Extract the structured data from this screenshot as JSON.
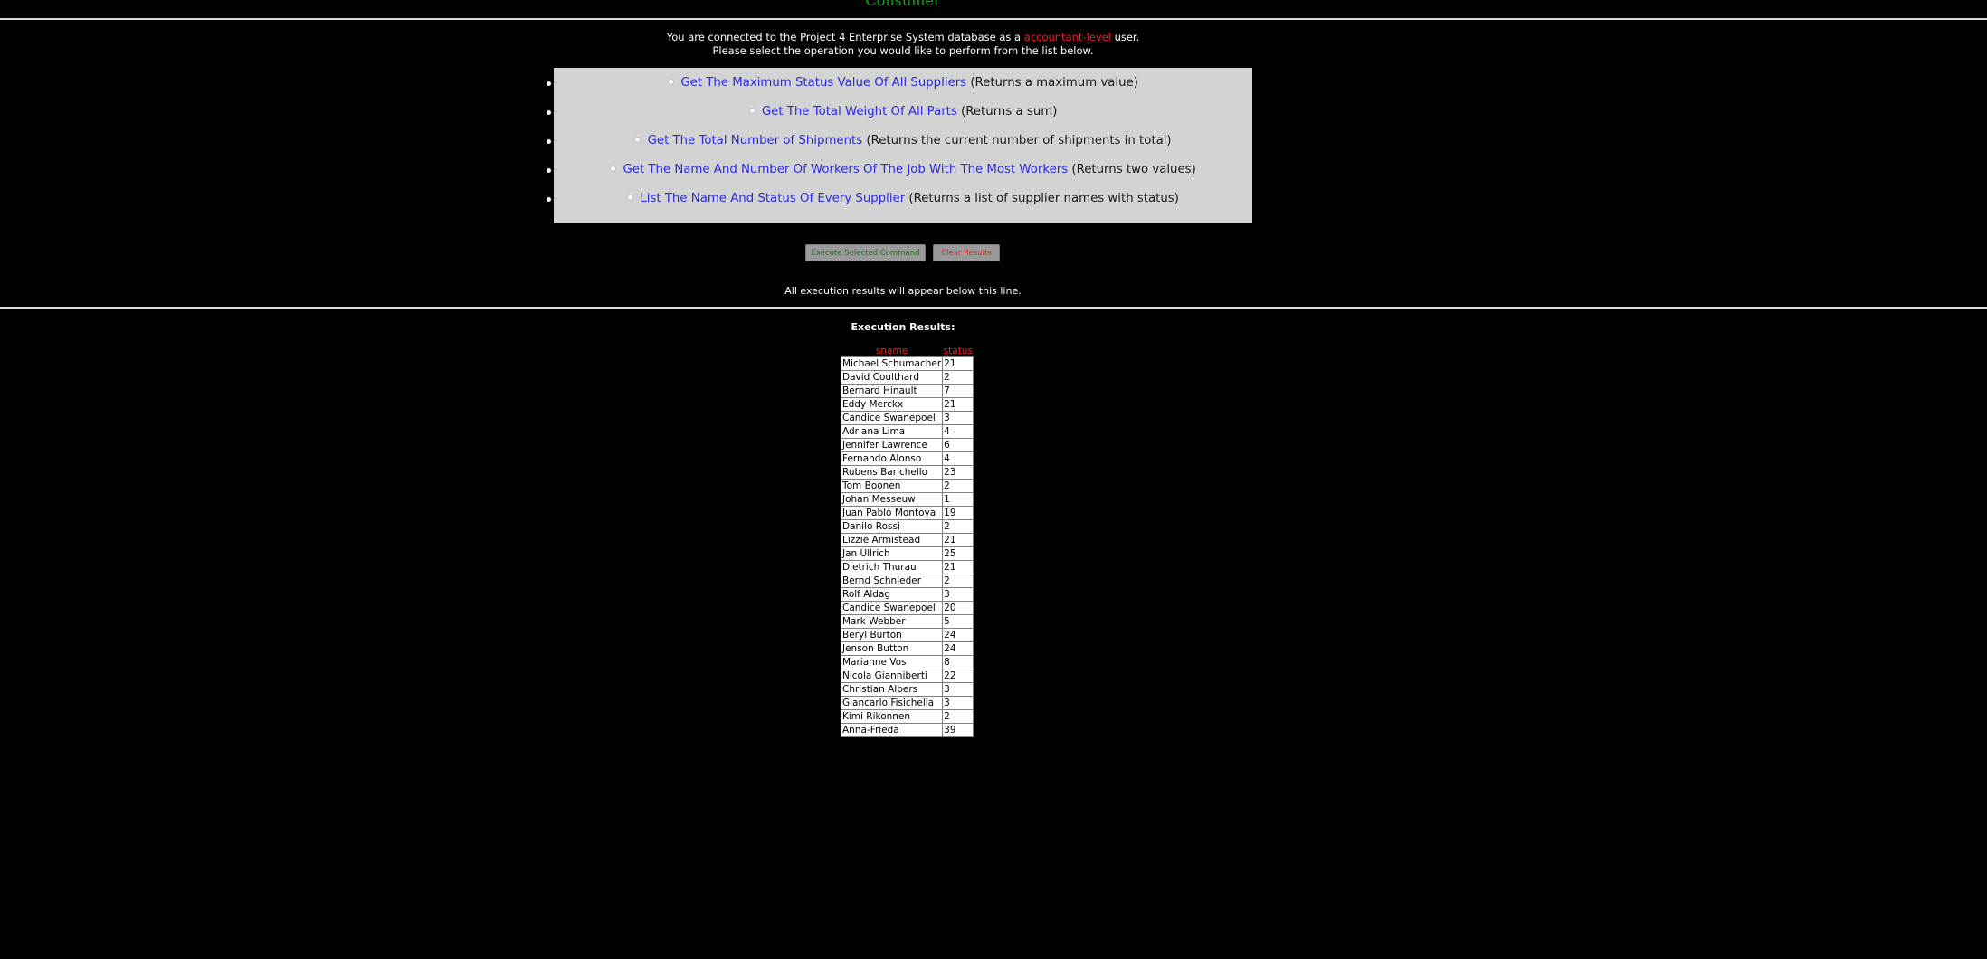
{
  "header": {
    "title": "Consumer"
  },
  "intro": {
    "line1_prefix": "You are connected to the Project 4 Enterprise System database as a",
    "role": "accountant-level",
    "line1_suffix": "user.",
    "line2": "Please select the operation you would like to perform from the list below."
  },
  "operations": [
    {
      "link": "Get The Maximum Status Value Of All Suppliers",
      "note": "(Returns a maximum value)"
    },
    {
      "link": "Get The Total Weight Of All Parts",
      "note": "(Returns a sum)"
    },
    {
      "link": "Get The Total Number of Shipments",
      "note": "(Returns the current number of shipments in total)"
    },
    {
      "link": "Get The Name And Number Of Workers Of The Job With The Most Workers",
      "note": "(Returns two values)"
    },
    {
      "link": "List The Name And Status Of Every Supplier",
      "note": "(Returns a list of supplier names with status)"
    }
  ],
  "buttons": {
    "execute": "Execute Selected Command",
    "clear": "Clear Results"
  },
  "results": {
    "note": "All execution results will appear below this line.",
    "heading": "Execution Results:",
    "columns": [
      "sname",
      "status"
    ],
    "rows": [
      [
        "Michael Schumacher",
        "21"
      ],
      [
        "David Coulthard",
        "2"
      ],
      [
        "Bernard Hinault",
        "7"
      ],
      [
        "Eddy Merckx",
        "21"
      ],
      [
        "Candice Swanepoel",
        "3"
      ],
      [
        "Adriana Lima",
        "4"
      ],
      [
        "Jennifer Lawrence",
        "6"
      ],
      [
        "Fernando Alonso",
        "4"
      ],
      [
        "Rubens Barichello",
        "23"
      ],
      [
        "Tom Boonen",
        "2"
      ],
      [
        "Johan Messeuw",
        "1"
      ],
      [
        "Juan Pablo Montoya",
        "19"
      ],
      [
        "Danilo Rossi",
        "2"
      ],
      [
        "Lizzie Armistead",
        "21"
      ],
      [
        "Jan Ullrich",
        "25"
      ],
      [
        "Dietrich Thurau",
        "21"
      ],
      [
        "Bernd Schnieder",
        "2"
      ],
      [
        "Rolf Aldag",
        "3"
      ],
      [
        "Candice Swanepoel",
        "20"
      ],
      [
        "Mark Webber",
        "5"
      ],
      [
        "Beryl Burton",
        "24"
      ],
      [
        "Jenson Button",
        "24"
      ],
      [
        "Marianne Vos",
        "8"
      ],
      [
        "Nicola Gianniberti",
        "22"
      ],
      [
        "Christian Albers",
        "3"
      ],
      [
        "Giancarlo Fisichella",
        "3"
      ],
      [
        "Kimi Rikonnen",
        "2"
      ],
      [
        "Anna-Frieda",
        "39"
      ]
    ]
  },
  "colors": {
    "background": "#000000",
    "title": "#18a418",
    "role": "#ff1a1a",
    "link": "#2a2adb",
    "panel": "#d3d3d3",
    "header_cells": "#ff1a1a"
  }
}
